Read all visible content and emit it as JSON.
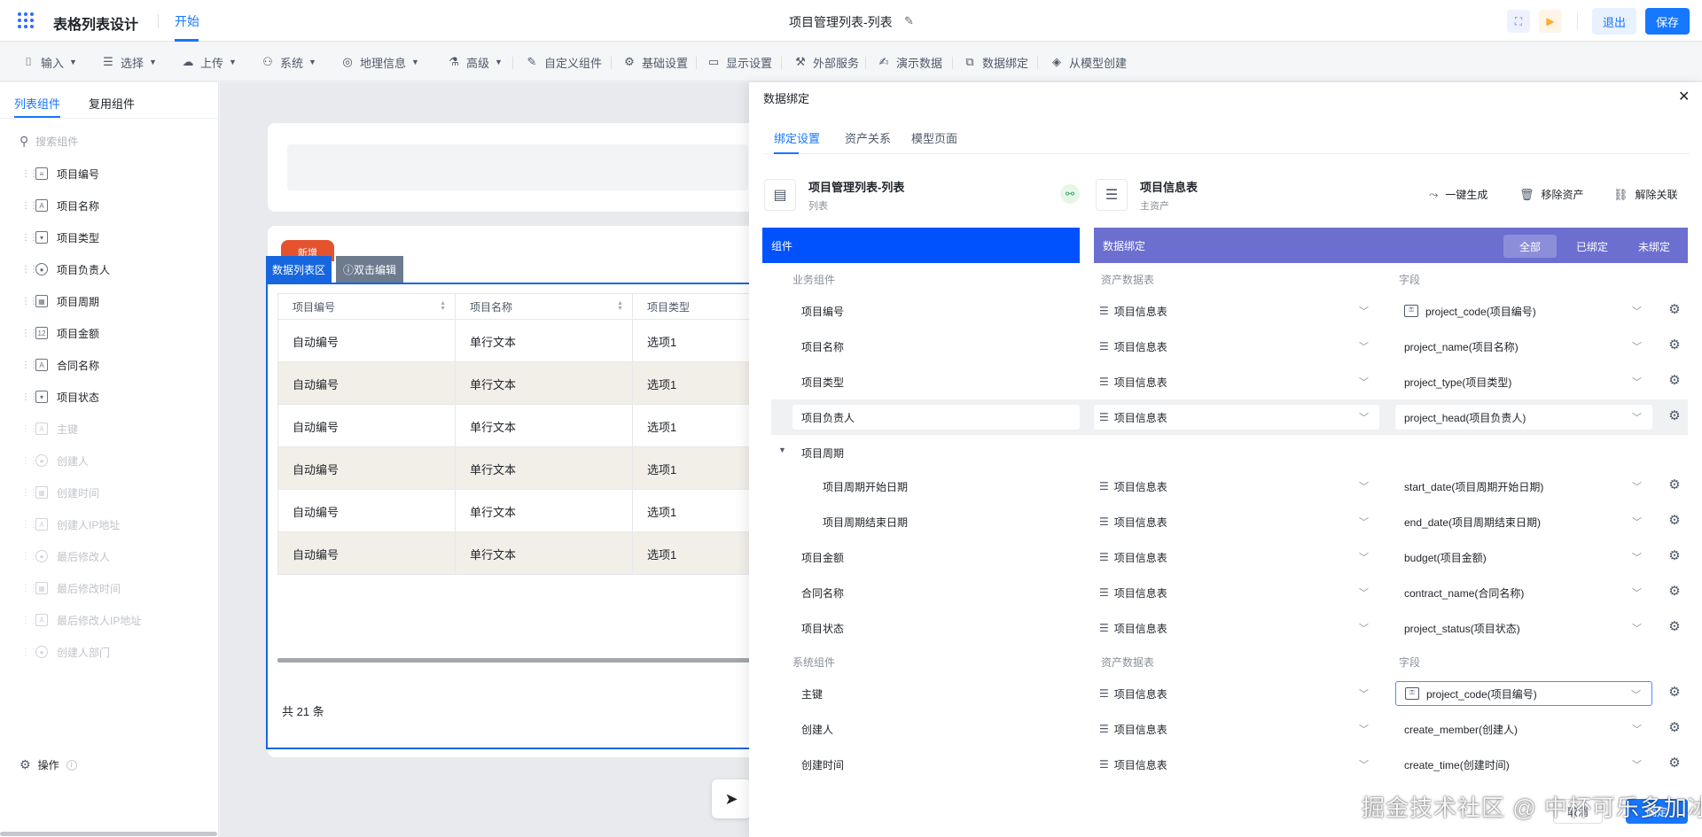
{
  "header": {
    "app_title": "表格列表设计",
    "tab_start": "开始",
    "doc_title": "项目管理列表-列表",
    "exit": "退出",
    "save": "保存"
  },
  "toolbar": {
    "items": [
      {
        "label": "输入",
        "icon": "input-icon",
        "caret": true
      },
      {
        "label": "选择",
        "icon": "select-icon",
        "caret": true
      },
      {
        "label": "上传",
        "icon": "cloud-upload-icon",
        "caret": true
      },
      {
        "label": "系统",
        "icon": "system-icon",
        "caret": true
      },
      {
        "label": "地理信息",
        "icon": "location-icon",
        "caret": true
      },
      {
        "label": "高级",
        "icon": "advanced-icon",
        "caret": true
      },
      {
        "label": "自定义组件",
        "icon": "edit-icon",
        "caret": false
      },
      {
        "label": "基础设置",
        "icon": "settings-icon",
        "caret": false
      },
      {
        "label": "显示设置",
        "icon": "display-icon",
        "caret": false
      },
      {
        "label": "外部服务",
        "icon": "service-icon",
        "caret": false
      },
      {
        "label": "演示数据",
        "icon": "demo-data-icon",
        "caret": false
      },
      {
        "label": "数据绑定",
        "icon": "data-bind-icon",
        "caret": false
      },
      {
        "label": "从模型创建",
        "icon": "model-icon",
        "caret": false
      }
    ]
  },
  "sidebar": {
    "tabs": [
      "列表组件",
      "复用组件"
    ],
    "search_placeholder": "搜索组件",
    "items": [
      {
        "label": "项目编号",
        "enabled": true
      },
      {
        "label": "项目名称",
        "enabled": true
      },
      {
        "label": "项目类型",
        "enabled": true
      },
      {
        "label": "项目负责人",
        "enabled": true
      },
      {
        "label": "项目周期",
        "enabled": true
      },
      {
        "label": "项目金额",
        "enabled": true
      },
      {
        "label": "合同名称",
        "enabled": true
      },
      {
        "label": "项目状态",
        "enabled": true
      },
      {
        "label": "主键",
        "enabled": false
      },
      {
        "label": "创建人",
        "enabled": false
      },
      {
        "label": "创建时间",
        "enabled": false
      },
      {
        "label": "创建人IP地址",
        "enabled": false
      },
      {
        "label": "最后修改人",
        "enabled": false
      },
      {
        "label": "最后修改时间",
        "enabled": false
      },
      {
        "label": "最后修改人IP地址",
        "enabled": false
      },
      {
        "label": "创建人部门",
        "enabled": false
      }
    ],
    "operation": "操作"
  },
  "canvas": {
    "new_button": "新增",
    "label_list_area": "数据列表区",
    "label_dblclick": "ⓘ双击编辑",
    "columns": [
      "项目编号",
      "项目名称",
      "项目类型"
    ],
    "rows": [
      [
        "自动编号",
        "单行文本",
        "选项1"
      ],
      [
        "自动编号",
        "单行文本",
        "选项1"
      ],
      [
        "自动编号",
        "单行文本",
        "选项1"
      ],
      [
        "自动编号",
        "单行文本",
        "选项1"
      ],
      [
        "自动编号",
        "单行文本",
        "选项1"
      ],
      [
        "自动编号",
        "单行文本",
        "选项1"
      ]
    ],
    "total": "共 21 条"
  },
  "drawer": {
    "title": "数据绑定",
    "tabs": [
      "绑定设置",
      "资产关系",
      "模型页面"
    ],
    "left_asset": {
      "name": "项目管理列表-列表",
      "sub": "列表"
    },
    "right_asset": {
      "name": "项目信息表",
      "sub": "主资产"
    },
    "actions": [
      "一键生成",
      "移除资产",
      "解除关联"
    ],
    "bar_component": "组件",
    "bar_binding": "数据绑定",
    "filters": [
      "全部",
      "已绑定",
      "未绑定"
    ],
    "section_business": {
      "a": "业务组件",
      "b": "资产数据表",
      "c": "字段"
    },
    "section_system": {
      "a": "系统组件",
      "b": "资产数据表",
      "c": "字段"
    },
    "business_rows": [
      {
        "comp": "项目编号",
        "table": "项目信息表",
        "field": "project_code(项目编号)",
        "field_icon": true
      },
      {
        "comp": "项目名称",
        "table": "项目信息表",
        "field": "project_name(项目名称)"
      },
      {
        "comp": "项目类型",
        "table": "项目信息表",
        "field": "project_type(项目类型)"
      },
      {
        "comp": "项目负责人",
        "table": "项目信息表",
        "field": "project_head(项目负责人)"
      },
      {
        "comp": "项目周期",
        "group": true
      },
      {
        "comp": "项目周期开始日期",
        "table": "项目信息表",
        "field": "start_date(项目周期开始日期)",
        "child": true
      },
      {
        "comp": "项目周期结束日期",
        "table": "项目信息表",
        "field": "end_date(项目周期结束日期)",
        "child": true
      },
      {
        "comp": "项目金额",
        "table": "项目信息表",
        "field": "budget(项目金额)"
      },
      {
        "comp": "合同名称",
        "table": "项目信息表",
        "field": "contract_name(合同名称)"
      },
      {
        "comp": "项目状态",
        "table": "项目信息表",
        "field": "project_status(项目状态)"
      }
    ],
    "system_rows": [
      {
        "comp": "主键",
        "table": "项目信息表",
        "field": "project_code(项目编号)",
        "field_icon": true
      },
      {
        "comp": "创建人",
        "table": "项目信息表",
        "field": "create_member(创建人)"
      },
      {
        "comp": "创建时间",
        "table": "项目信息表",
        "field": "create_time(创建时间)"
      }
    ],
    "cancel": "取消",
    "confirm": "确定"
  },
  "watermark": "掘金技术社区 @ 中杯可乐多加冰",
  "colors": {
    "primary": "#1677ff",
    "component_bar": "#0052ff",
    "binding_bar": "#6c6fd0",
    "new_button": "#e4532e"
  }
}
